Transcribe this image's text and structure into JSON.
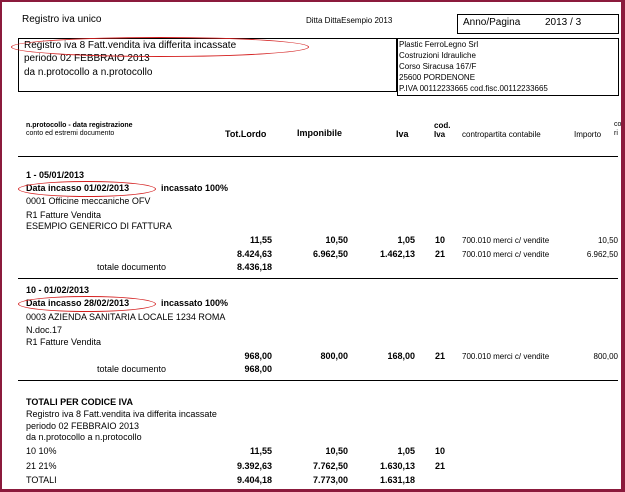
{
  "header": {
    "title": "Registro iva unico",
    "company": "Ditta DittaEsempio 2013",
    "anno_pagina_label": "Anno/Pagina",
    "anno_pagina_value": "2013 /   3"
  },
  "left_box": {
    "line1": "Registro iva 8 Fatt.vendita iva differita incassate",
    "line2": "periodo 02 FEBBRAIO 2013",
    "line3": "da n.protocollo   a n.protocollo"
  },
  "right_box": {
    "lines": [
      "Plastic FerroLegno Srl",
      "Costruzioni Idrauliche",
      "Corso Siracusa 167/F",
      "25600 PORDENONE",
      "P.IVA 00112233665 cod.fisc.00112233665"
    ]
  },
  "columns": {
    "protocol_line1": "n.protocollo - data registrazione",
    "protocol_line2": "conto ed estremi documento",
    "tot_lordo": "Tot.Lordo",
    "imponibile": "Imponibile",
    "iva": "Iva",
    "cod_line1": "cod.",
    "cod_line2": "Iva",
    "contropartita": "contropartita contabile",
    "importo": "Importo",
    "cod_iva_short_1": "co",
    "cod_iva_short_2": "ri"
  },
  "doc1": {
    "header": "1 - 05/01/2013",
    "incasso": "Data incasso 01/02/2013",
    "incassato": "incassato 100%",
    "customer": "0001 Officine meccaniche OFV",
    "causale": "R1 Fatture Vendita",
    "descr": "ESEMPIO GENERICO DI FATTURA",
    "rows": [
      {
        "lordo": "11,55",
        "imponibile": "10,50",
        "iva": "1,05",
        "cod": "10",
        "contro": "700.010 merci c/ vendite",
        "importo": "10,50"
      },
      {
        "lordo": "8.424,63",
        "imponibile": "6.962,50",
        "iva": "1.462,13",
        "cod": "21",
        "contro": "700.010 merci c/ vendite",
        "importo": "6.962,50"
      }
    ],
    "totale_label": "totale documento",
    "totale_value": "8.436,18"
  },
  "doc2": {
    "header": "10 - 01/02/2013",
    "incasso": "Data incasso 28/02/2013",
    "incassato": "incassato 100%",
    "customer": "0003 AZIENDA SANITARIA LOCALE 1234 ROMA",
    "ndoc": "N.doc.17",
    "causale": "R1 Fatture Vendita",
    "rows": [
      {
        "lordo": "968,00",
        "imponibile": "800,00",
        "iva": "168,00",
        "cod": "21",
        "contro": "700.010 merci c/ vendite",
        "importo": "800,00"
      }
    ],
    "totale_label": "totale documento",
    "totale_value": "968,00"
  },
  "totali": {
    "title": "TOTALI PER CODICE IVA",
    "line1": "Registro iva 8 Fatt.vendita iva differita incassate",
    "line2": "periodo 02 FEBBRAIO 2013",
    "line3": "da n.protocollo   a n.protocollo",
    "rows": [
      {
        "label": "10 10%",
        "lordo": "11,55",
        "imponibile": "10,50",
        "iva": "1,05",
        "cod": "10"
      },
      {
        "label": "21 21%",
        "lordo": "9.392,63",
        "imponibile": "7.762,50",
        "iva": "1.630,13",
        "cod": "21"
      },
      {
        "label": "TOTALI",
        "lordo": "9.404,18",
        "imponibile": "7.773,00",
        "iva": "1.631,18",
        "cod": ""
      }
    ]
  },
  "colors": {
    "frame": "#8b1a3c",
    "highlight_oval": "#d42020"
  }
}
